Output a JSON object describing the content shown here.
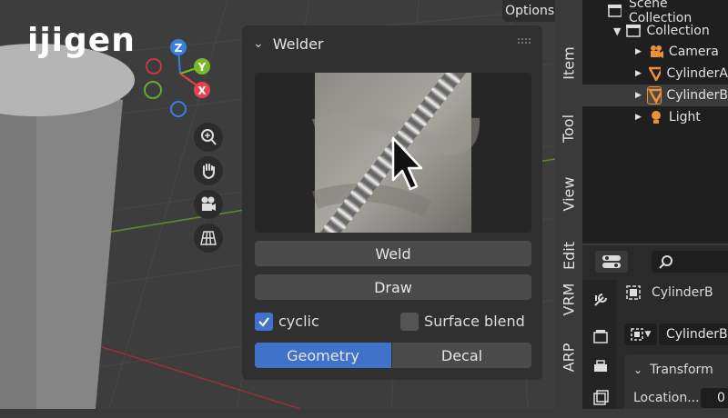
{
  "viewport": {
    "logo_text": "ijigen",
    "options_label": "Options",
    "gizmo": {
      "z": "Z",
      "y": "Y",
      "x": "X"
    },
    "nav_icons": [
      "zoom-icon",
      "hand-icon",
      "camera-icon",
      "grid-icon"
    ]
  },
  "welder": {
    "title": "Welder",
    "weld_label": "Weld",
    "draw_label": "Draw",
    "cyclic_label": "cyclic",
    "cyclic_checked": true,
    "surface_blend_label": "Surface blend",
    "surface_blend_checked": false,
    "segment": [
      "Geometry",
      "Decal"
    ],
    "segment_active": "Geometry"
  },
  "sidebar_tabs": [
    "Item",
    "Tool",
    "View",
    "Edit",
    "VRM",
    "ARP"
  ],
  "outliner": {
    "scene_collection": "Scene Collection",
    "collection": "Collection",
    "items": [
      "Camera",
      "CylinderA",
      "CylinderB",
      "Light"
    ],
    "selected": "CylinderB"
  },
  "properties": {
    "object_name": "CylinderB",
    "dropdown_value": "CylinderB",
    "transform_label": "Transform",
    "location_label": "Location...",
    "location_value": "0"
  },
  "colors": {
    "accent_blue": "#3f72c8",
    "orange": "#e8903c",
    "axis_x": "#e8404f",
    "axis_y": "#7ab82a",
    "axis_z": "#3a7fd9"
  }
}
